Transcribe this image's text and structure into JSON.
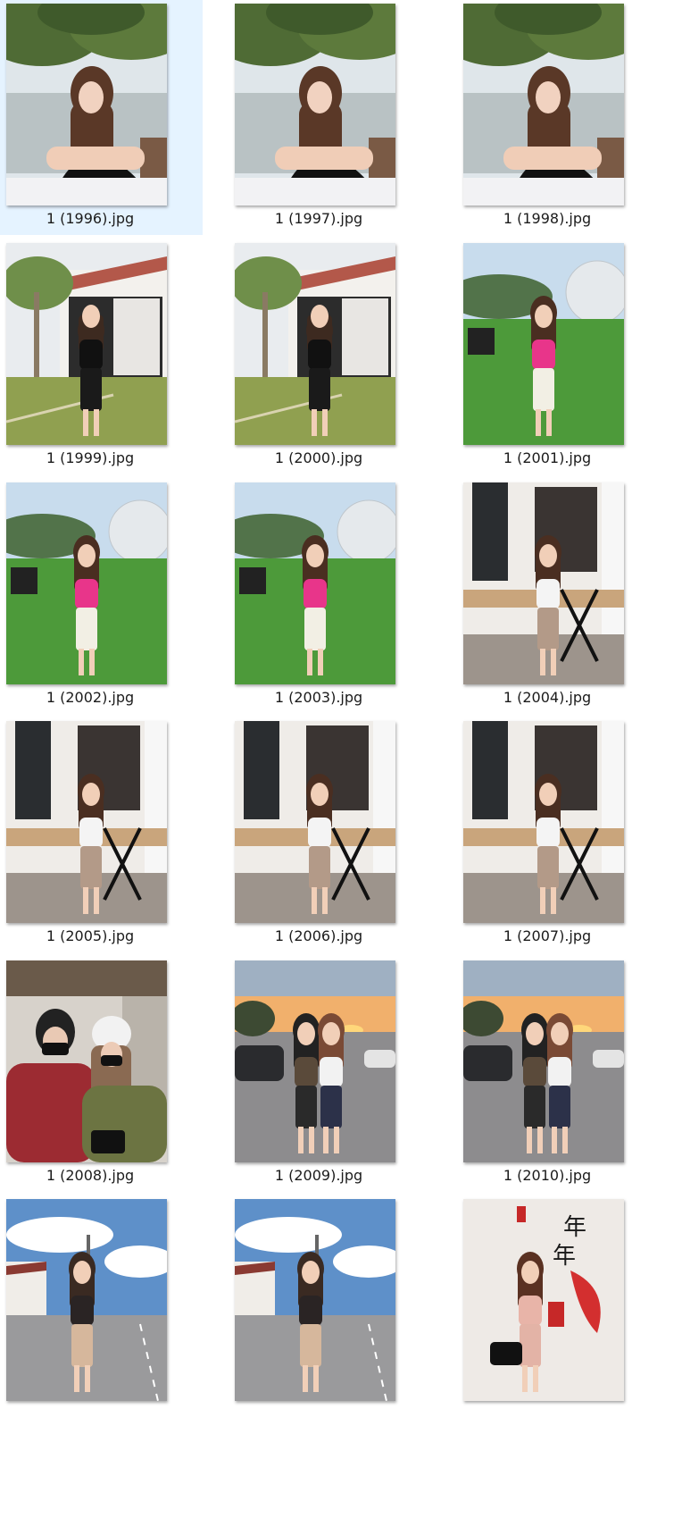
{
  "files": [
    {
      "name": "1 (1996).jpg",
      "scene": "seaside",
      "selected": true
    },
    {
      "name": "1 (1997).jpg",
      "scene": "seaside",
      "selected": false
    },
    {
      "name": "1 (1998).jpg",
      "scene": "seaside",
      "selected": false
    },
    {
      "name": "1 (1999).jpg",
      "scene": "villa",
      "selected": false
    },
    {
      "name": "1 (2000).jpg",
      "scene": "villa",
      "selected": false
    },
    {
      "name": "1 (2001).jpg",
      "scene": "lawn",
      "selected": false
    },
    {
      "name": "1 (2002).jpg",
      "scene": "lawn",
      "selected": false
    },
    {
      "name": "1 (2003).jpg",
      "scene": "lawn",
      "selected": false
    },
    {
      "name": "1 (2004).jpg",
      "scene": "cafe",
      "selected": false
    },
    {
      "name": "1 (2005).jpg",
      "scene": "cafe",
      "selected": false
    },
    {
      "name": "1 (2006).jpg",
      "scene": "cafe",
      "selected": false
    },
    {
      "name": "1 (2007).jpg",
      "scene": "cafe",
      "selected": false
    },
    {
      "name": "1 (2008).jpg",
      "scene": "mall",
      "selected": false
    },
    {
      "name": "1 (2009).jpg",
      "scene": "sunset-street",
      "selected": false
    },
    {
      "name": "1 (2010).jpg",
      "scene": "sunset-street",
      "selected": false
    },
    {
      "name": "",
      "scene": "day-street",
      "selected": false
    },
    {
      "name": "",
      "scene": "day-street",
      "selected": false
    },
    {
      "name": "",
      "scene": "red-wall",
      "selected": false
    }
  ],
  "wall_text": [
    "年",
    "年"
  ],
  "colors": {
    "selection": "#e5f3ff",
    "label": "#1b1b1b",
    "pink_top": "#e8358a"
  }
}
